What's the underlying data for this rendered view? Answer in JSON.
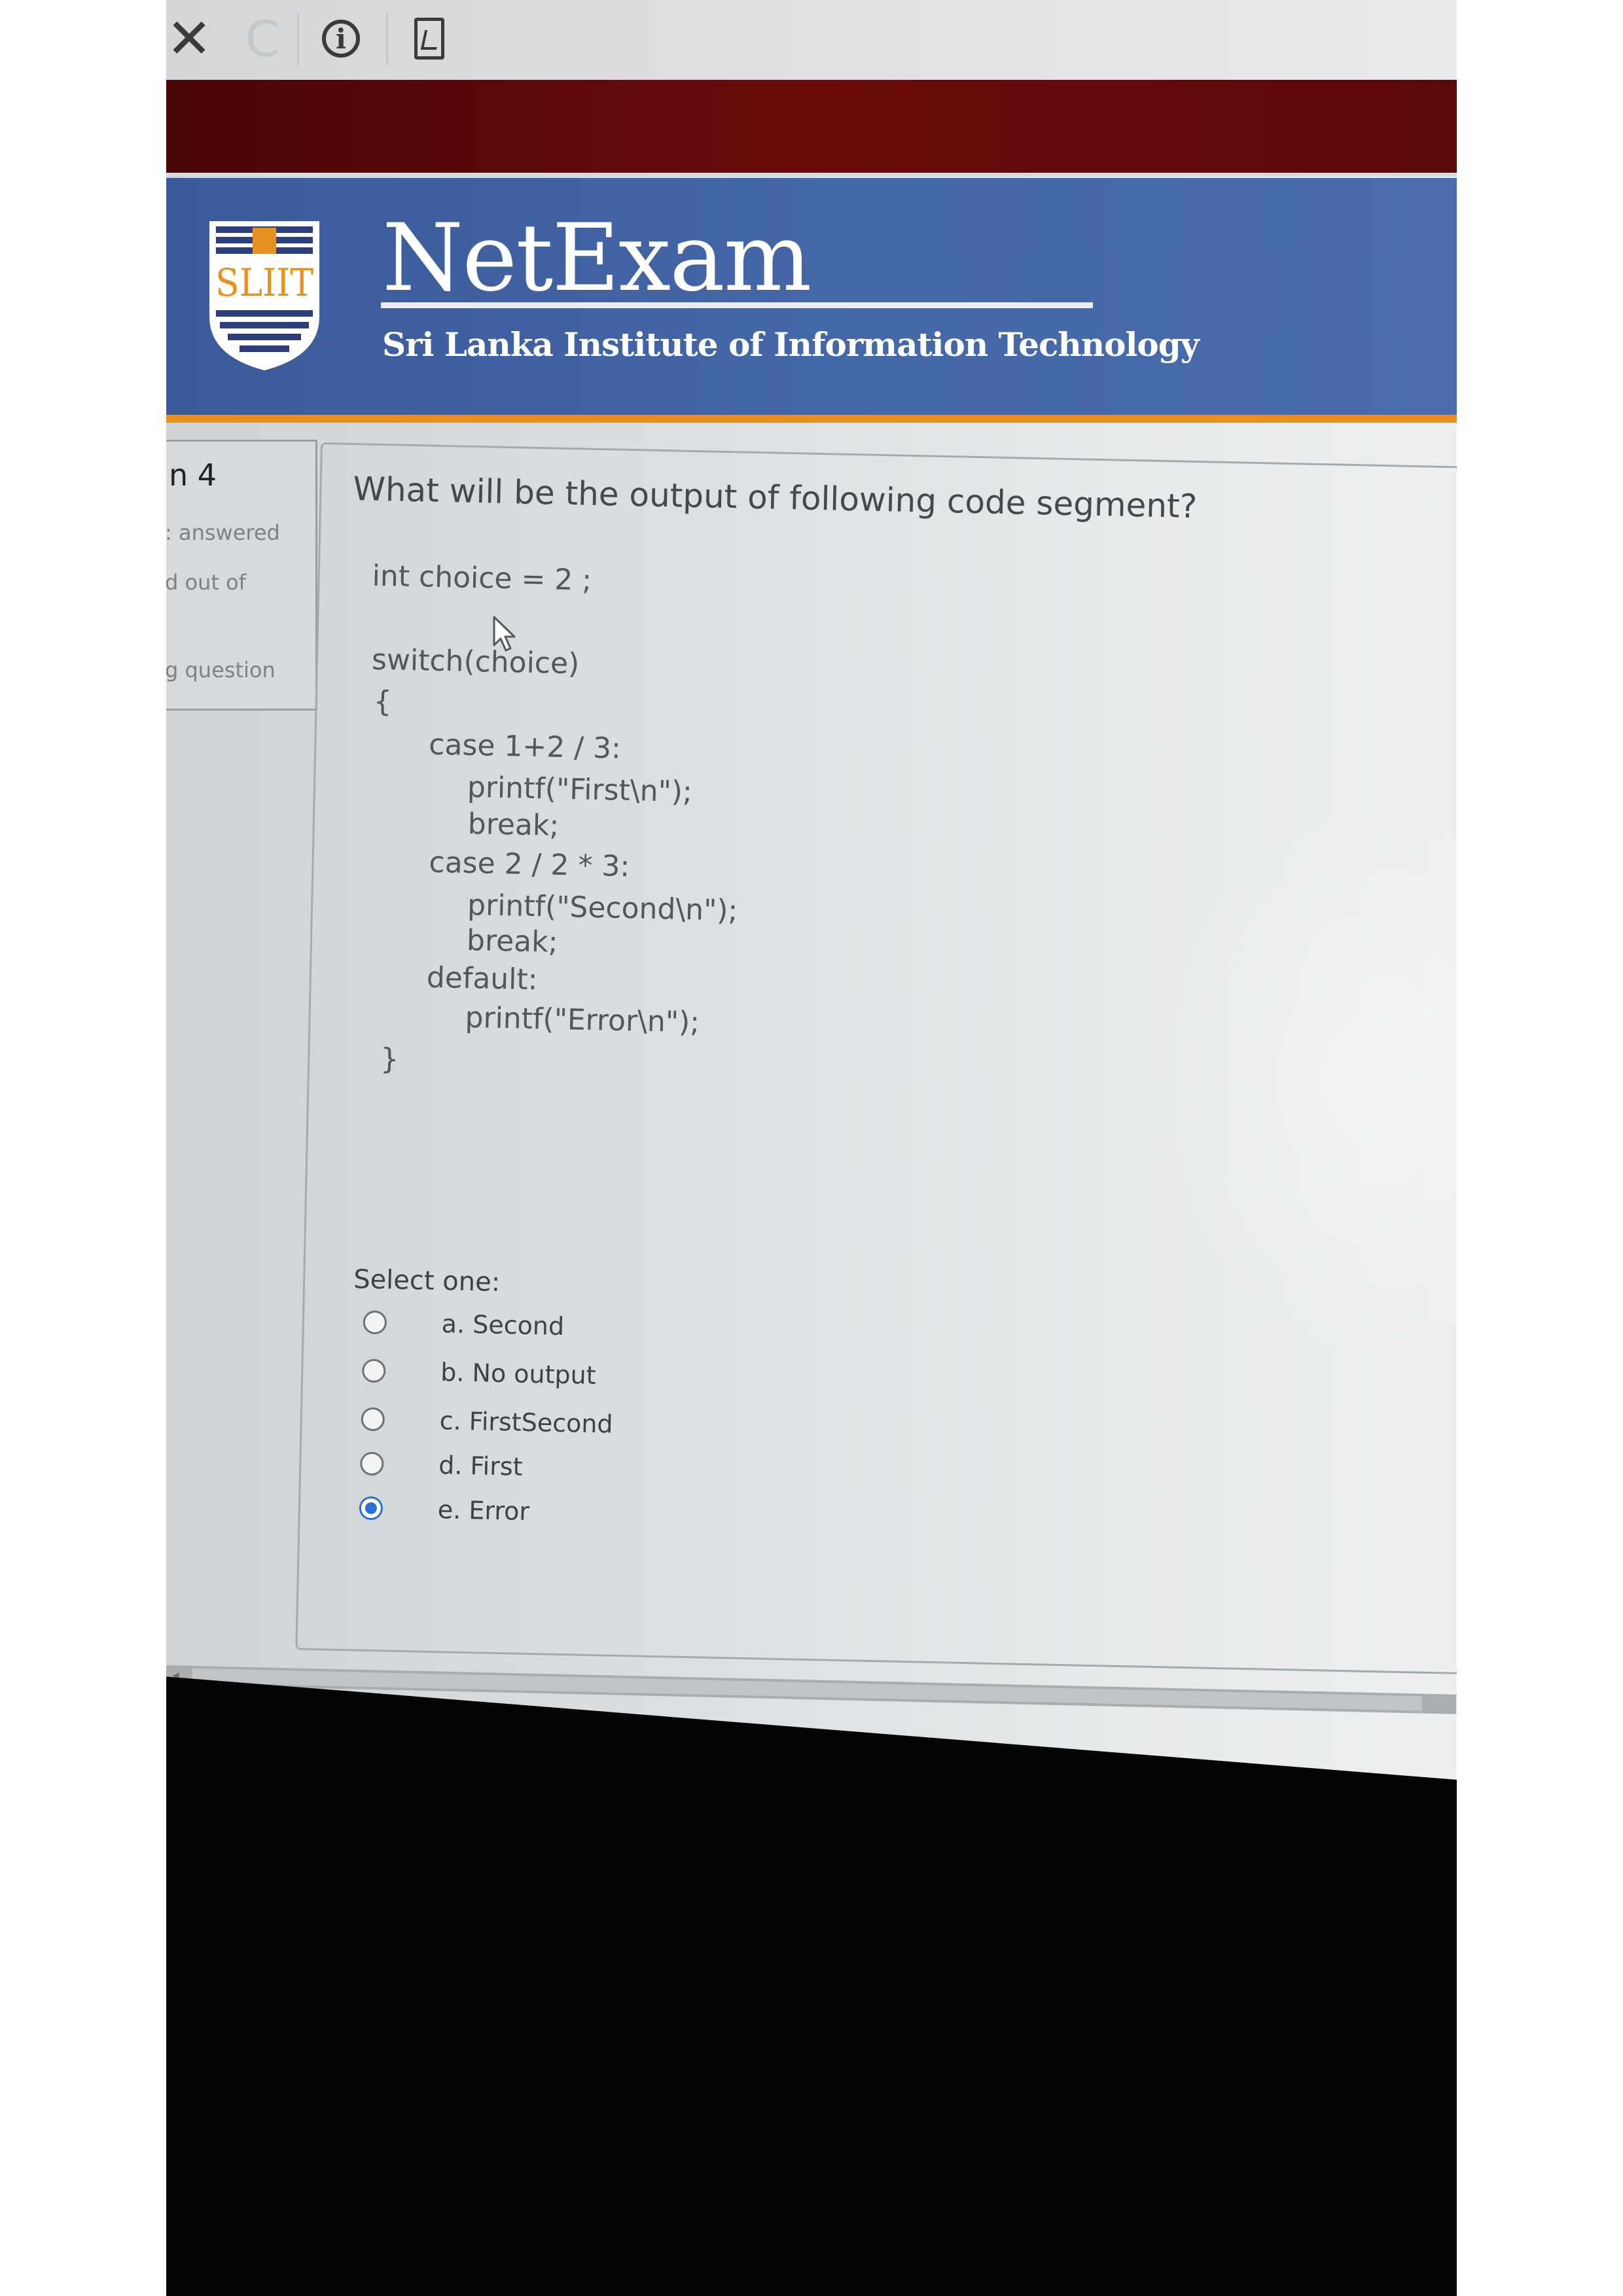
{
  "browser": {
    "close_icon": "close-icon",
    "reload_icon": "reload-icon",
    "info_icon": "info-icon",
    "page_icon": "page-icon"
  },
  "header": {
    "logo_text": "SLIIT",
    "brand": "NetExam",
    "tagline": "Sri Lanka Institute of Information Technology",
    "colors": {
      "red_band": "#5a0808",
      "blue": "#4467a8",
      "orange_rule": "#e8901d"
    }
  },
  "question_info": {
    "number": "n 4",
    "status": ": answered",
    "marks": "d out of",
    "flag": "g question"
  },
  "question": {
    "prompt": "What will be the output of following code segment?",
    "code_lines": [
      "int choice = 2 ;",
      "switch(choice)",
      "{",
      "case 1+2 / 3:",
      "printf(\"First\\n\");",
      "break;",
      "case 2 / 2 * 3:",
      "printf(\"Second\\n\");",
      "break;",
      "default:",
      "printf(\"Error\\n\");",
      "}"
    ],
    "select_label": "Select one:",
    "options": [
      {
        "label": "a. Second",
        "selected": false
      },
      {
        "label": "b. No output",
        "selected": false
      },
      {
        "label": "c. FirstSecond",
        "selected": false
      },
      {
        "label": "d. First",
        "selected": false
      },
      {
        "label": "e. Error",
        "selected": true
      }
    ]
  }
}
